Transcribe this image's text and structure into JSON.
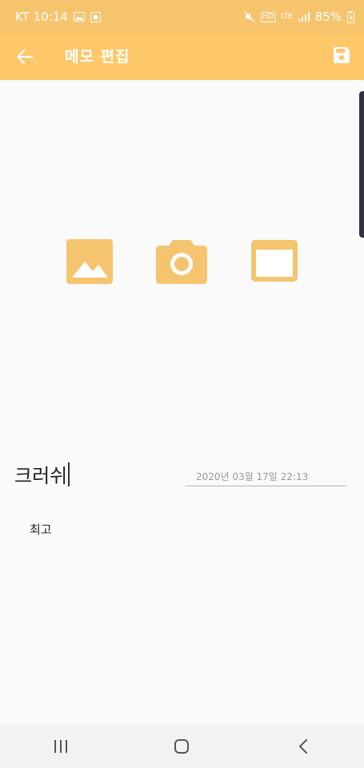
{
  "status_bar": {
    "carrier_time": "KT 10:14",
    "hd_label": "HD",
    "lte_label": "LTE",
    "battery_text": "85%"
  },
  "app_bar": {
    "title": "메모 편집"
  },
  "memo": {
    "title": "크러쉬",
    "date": "2020년 03월 17일 22:13",
    "body": "최고"
  },
  "icons": {
    "back": "arrow-left-icon",
    "save": "floppy-disk-icon",
    "gallery": "image-icon",
    "camera": "camera-icon",
    "frame": "window-frame-icon"
  },
  "colors": {
    "status_bar": "#f7c46e",
    "app_bar": "#fec76a",
    "icon_accent": "#f4c46f",
    "background": "#fafafa"
  }
}
